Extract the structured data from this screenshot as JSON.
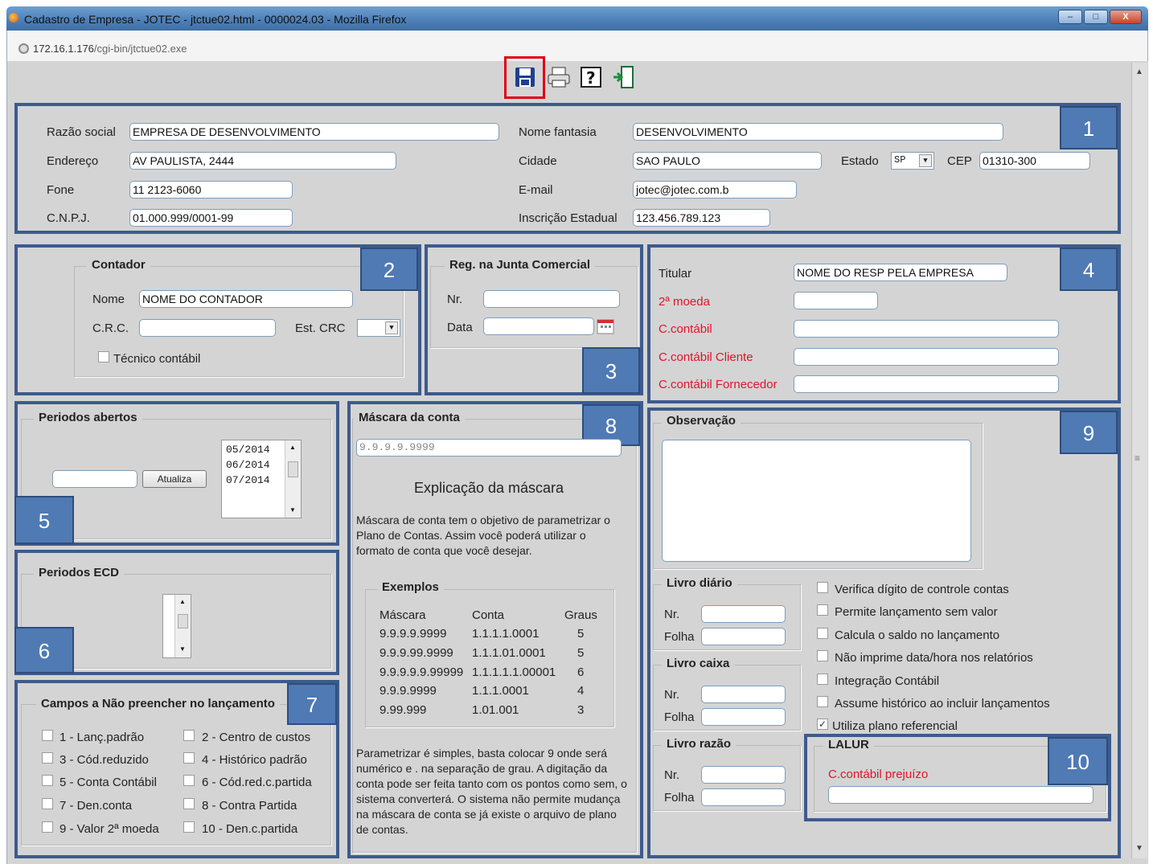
{
  "window": {
    "title": "Cadastro de Empresa - JOTEC - jtctue02.html - 0000024.03 - Mozilla Firefox",
    "url_host": "172.16.1.176",
    "url_path": "/cgi-bin/jtctue02.exe",
    "btn_min": "–",
    "btn_max": "□",
    "btn_close": "X"
  },
  "toolbar": {
    "save_icon": "floppy-disk-icon",
    "print_icon": "printer-icon",
    "help_icon": "help-icon",
    "exit_icon": "exit-door-icon"
  },
  "badges": [
    "1",
    "2",
    "3",
    "4",
    "5",
    "6",
    "7",
    "8",
    "9",
    "10"
  ],
  "empresa": {
    "razao_label": "Razão social",
    "razao_value": "EMPRESA DE DESENVOLVIMENTO",
    "fantasia_label": "Nome fantasia",
    "fantasia_value": "DESENVOLVIMENTO",
    "endereco_label": "Endereço",
    "endereco_value": "AV PAULISTA, 2444",
    "cidade_label": "Cidade",
    "cidade_value": "SAO PAULO",
    "estado_label": "Estado",
    "estado_value": "SP",
    "cep_label": "CEP",
    "cep_value": "01310-300",
    "fone_label": "Fone",
    "fone_value": "11 2123-6060",
    "email_label": "E-mail",
    "email_value": "jotec@jotec.com.b",
    "cnpj_label": "C.N.P.J.",
    "cnpj_value": "01.000.999/0001-99",
    "ie_label": "Inscrição Estadual",
    "ie_value": "123.456.789.123"
  },
  "contador": {
    "legend": "Contador",
    "nome_label": "Nome",
    "nome_value": "NOME DO CONTADOR",
    "crc_label": "C.R.C.",
    "crc_value": "",
    "estcrc_label": "Est. CRC",
    "estcrc_value": "",
    "tecnico_label": "Técnico contábil"
  },
  "junta": {
    "legend": "Reg. na Junta Comercial",
    "nr_label": "Nr.",
    "nr_value": "",
    "data_label": "Data",
    "data_value": ""
  },
  "titular": {
    "titular_label": "Titular",
    "titular_value": "NOME DO RESP PELA EMPRESA",
    "moeda_label": "2ª moeda",
    "moeda_value": "",
    "contabil_label": "C.contábil",
    "contabil_value": "",
    "cliente_label": "C.contábil Cliente",
    "cliente_value": "",
    "fornecedor_label": "C.contábil Fornecedor",
    "fornecedor_value": ""
  },
  "periodos": {
    "legend": "Periodos abertos",
    "input_value": "",
    "button": "Atualiza",
    "items": [
      "05/2014",
      "06/2014",
      "07/2014"
    ]
  },
  "ecd": {
    "legend": "Periodos ECD"
  },
  "campos": {
    "legend": "Campos a Não preencher no lançamento",
    "items": [
      "1 - Lanç.padrão",
      "2 - Centro de custos",
      "3 - Cód.reduzido",
      "4 - Histórico padrão",
      "5 - Conta Contábil",
      "6 - Cód.red.c.partida",
      "7 - Den.conta",
      "8 - Contra Partida",
      "9 - Valor 2ª moeda",
      "10 - Den.c.partida"
    ]
  },
  "mascara": {
    "legend": "Máscara da conta",
    "value": "9.9.9.9.9999",
    "expl_title": "Explicação da máscara",
    "para1": "Máscara de conta tem o objetivo de parametrizar o Plano de Contas. Assim você poderá utilizar o formato de conta que você desejar.",
    "exemplos_legend": "Exemplos",
    "headers": [
      "Máscara",
      "Conta",
      "Graus"
    ],
    "rows": [
      [
        "9.9.9.9.9999",
        "1.1.1.1.0001",
        "5"
      ],
      [
        "9.9.9.99.9999",
        "1.1.1.01.0001",
        "5"
      ],
      [
        "9.9.9.9.9.99999",
        "1.1.1.1.1.00001",
        "6"
      ],
      [
        "9.9.9.9999",
        "1.1.1.0001",
        "4"
      ],
      [
        "9.99.999",
        "1.01.001",
        "3"
      ]
    ],
    "para2": "Parametrizar é simples, basta colocar 9 onde será numérico e . na separação de grau. A digitação da conta pode ser feita tanto com os pontos como sem, o sistema converterá. O sistema não permite mudança na máscara de conta se já existe o arquivo de plano de contas."
  },
  "obs": {
    "legend": "Observação",
    "value": ""
  },
  "livros": [
    {
      "legend": "Livro diário",
      "nr_label": "Nr.",
      "folha_label": "Folha"
    },
    {
      "legend": "Livro caixa",
      "nr_label": "Nr.",
      "folha_label": "Folha"
    },
    {
      "legend": "Livro razão",
      "nr_label": "Nr.",
      "folha_label": "Folha"
    }
  ],
  "opcoes": [
    {
      "label": "Verifica dígito de controle contas",
      "checked": false
    },
    {
      "label": "Permite lançamento sem valor",
      "checked": false
    },
    {
      "label": "Calcula o saldo no lançamento",
      "checked": false
    },
    {
      "label": "Não imprime data/hora nos relatórios",
      "checked": false
    },
    {
      "label": "Integração Contábil",
      "checked": false
    },
    {
      "label": "Assume histórico ao incluir lançamentos",
      "checked": false
    },
    {
      "label": "Utiliza plano referencial",
      "checked": true
    }
  ],
  "lalur": {
    "legend": "LALUR",
    "label": "C.contábil prejuízo",
    "value": ""
  }
}
